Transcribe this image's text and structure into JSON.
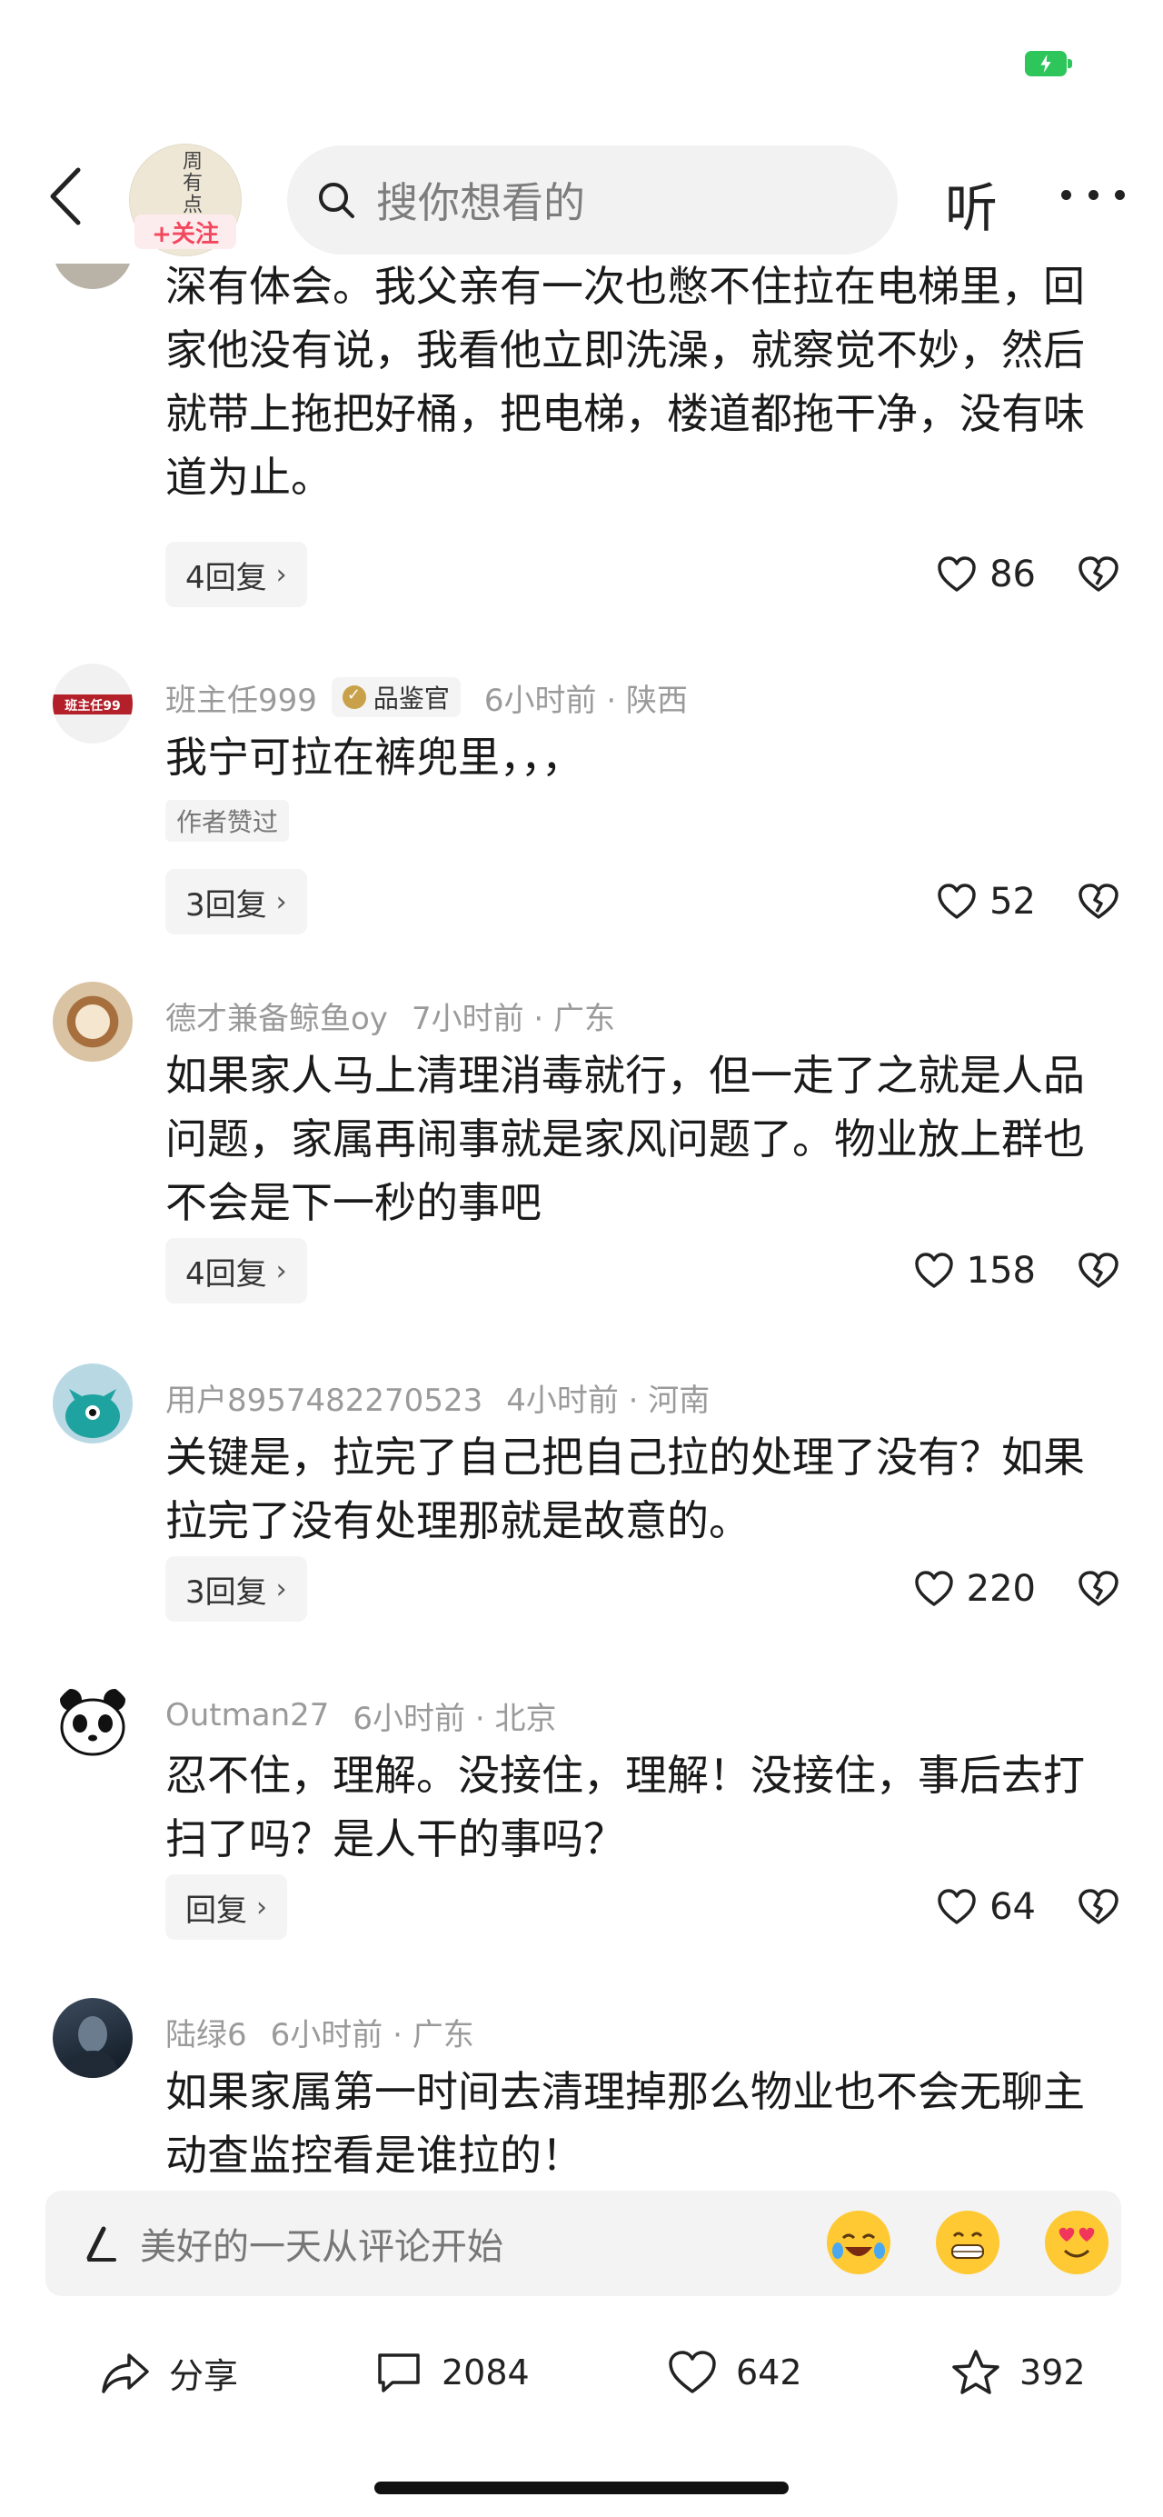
{
  "header": {
    "follow_label": "+关注",
    "search_placeholder": "搜你想看的",
    "listen_label": "听"
  },
  "comments": [
    {
      "text": "深有体会。我父亲有一次也憋不住拉在电梯里，回家他没有说，我看他立即洗澡，就察觉不妙，然后就带上拖把好桶，把电梯，楼道都拖干净，没有味道为止。",
      "reply_label": "4回复",
      "likes": "86"
    },
    {
      "username": "班主任999",
      "badge": "品鉴官",
      "time_location": "6小时前 · 陕西",
      "text": "我宁可拉在裤兜里，，，",
      "liked_tag": "作者赞过",
      "reply_label": "3回复",
      "likes": "52"
    },
    {
      "username": "德才兼备鲸鱼oy",
      "time_location": "7小时前 · 广东",
      "text": "如果家人马上清理消毒就行，但一走了之就是人品问题，家属再闹事就是家风问题了。物业放上群也不会是下一秒的事吧",
      "reply_label": "4回复",
      "likes": "158"
    },
    {
      "username": "用户8957482270523",
      "time_location": "4小时前 · 河南",
      "text": "关键是，拉完了自己把自己拉的处理了没有？如果拉完了没有处理那就是故意的。",
      "reply_label": "3回复",
      "likes": "220"
    },
    {
      "username": "Outman27",
      "time_location": "6小时前 · 北京",
      "text": "忍不住，理解。没接住，理解！没接住，事后去打扫了吗？是人干的事吗？",
      "reply_label": "回复",
      "likes": "64"
    },
    {
      "username": "陆绿6",
      "time_location": "6小时前 · 广东",
      "text": "如果家属第一时间去清理掉那么物业也不会无聊主动查监控看是谁拉的！"
    }
  ],
  "comment_input": {
    "placeholder": "美好的一天从评论开始"
  },
  "actions": {
    "share": "分享",
    "comments": "2084",
    "likes": "642",
    "favorites": "392"
  }
}
